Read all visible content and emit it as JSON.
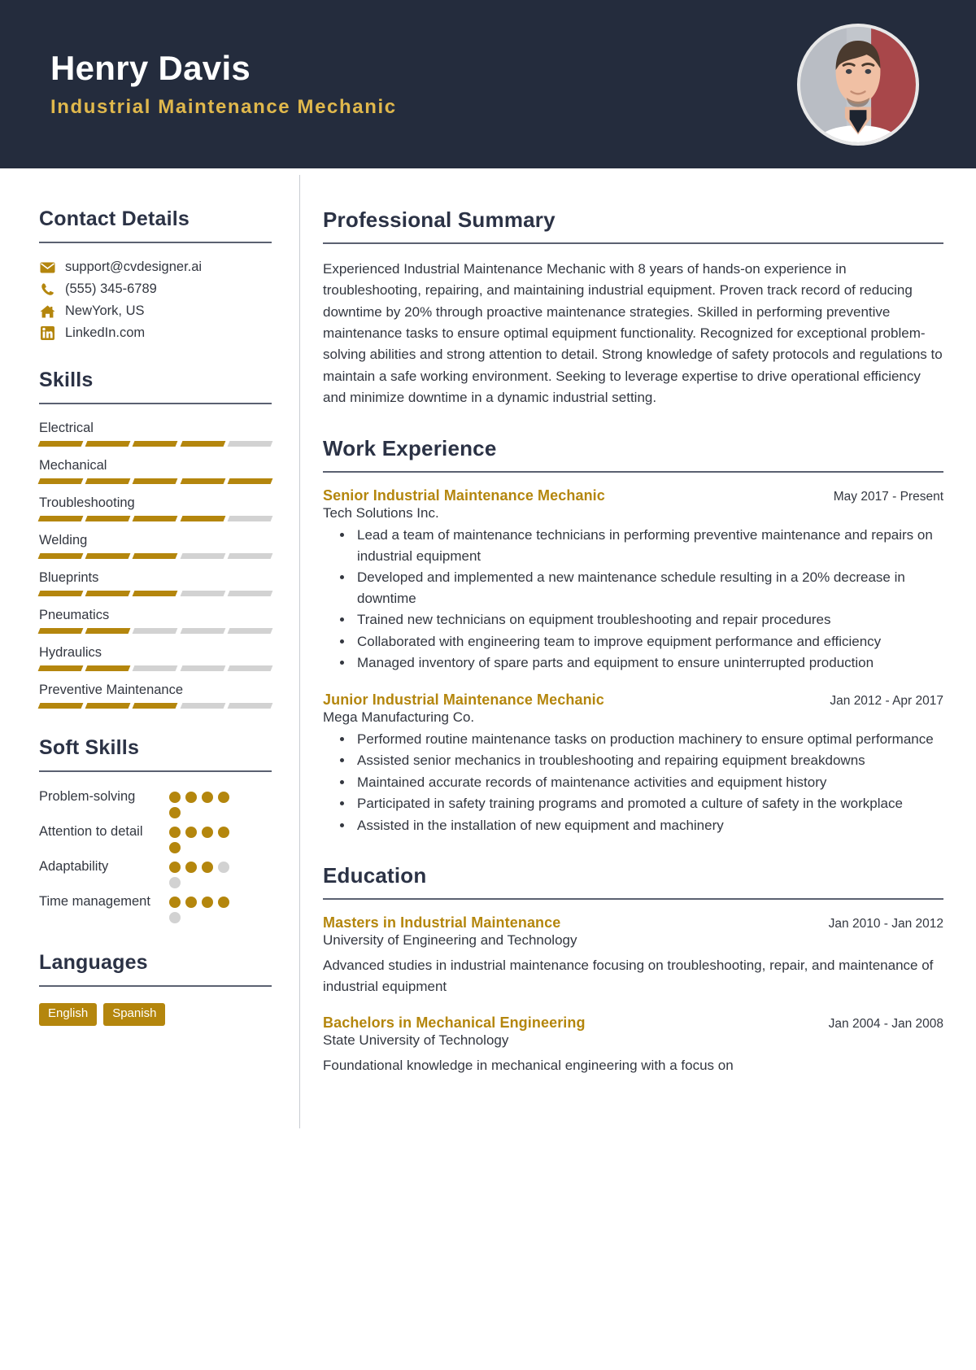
{
  "header": {
    "name": "Henry Davis",
    "job_title": "Industrial Maintenance Mechanic",
    "avatar_icon": "user-photo",
    "bg_color": "#242c3d",
    "accent_color": "#e0b84c"
  },
  "theme": {
    "accent": "#b4860d",
    "dark": "#2b3245",
    "muted": "#d2d2d2"
  },
  "sidebar": {
    "contact": {
      "heading": "Contact Details",
      "items": [
        {
          "icon": "envelope-icon",
          "value": "support@cvdesigner.ai"
        },
        {
          "icon": "phone-icon",
          "value": "(555) 345-6789"
        },
        {
          "icon": "home-icon",
          "value": "NewYork, US"
        },
        {
          "icon": "linkedin-icon",
          "value": "LinkedIn.com"
        }
      ]
    },
    "skills": {
      "heading": "Skills",
      "max": 5,
      "items": [
        {
          "name": "Electrical",
          "level": 4
        },
        {
          "name": "Mechanical",
          "level": 5
        },
        {
          "name": "Troubleshooting",
          "level": 4
        },
        {
          "name": "Welding",
          "level": 3
        },
        {
          "name": "Blueprints",
          "level": 3
        },
        {
          "name": "Pneumatics",
          "level": 2
        },
        {
          "name": "Hydraulics",
          "level": 2
        },
        {
          "name": "Preventive Maintenance",
          "level": 3
        }
      ]
    },
    "soft_skills": {
      "heading": "Soft Skills",
      "max": 5,
      "items": [
        {
          "name": "Problem-solving",
          "level": 5
        },
        {
          "name": "Attention to detail",
          "level": 5
        },
        {
          "name": "Adaptability",
          "level": 3
        },
        {
          "name": "Time management",
          "level": 4
        }
      ]
    },
    "languages": {
      "heading": "Languages",
      "items": [
        "English",
        "Spanish"
      ]
    }
  },
  "main": {
    "summary": {
      "heading": "Professional Summary",
      "text": "Experienced Industrial Maintenance Mechanic with 8 years of hands-on experience in troubleshooting, repairing, and maintaining industrial equipment. Proven track record of reducing downtime by 20% through proactive maintenance strategies. Skilled in performing preventive maintenance tasks to ensure optimal equipment functionality. Recognized for exceptional problem-solving abilities and strong attention to detail. Strong knowledge of safety protocols and regulations to maintain a safe working environment. Seeking to leverage expertise to drive operational efficiency and minimize downtime in a dynamic industrial setting."
    },
    "work_experience": {
      "heading": "Work Experience",
      "entries": [
        {
          "title": "Senior Industrial Maintenance Mechanic",
          "date": "May 2017 - Present",
          "organization": "Tech Solutions Inc.",
          "bullets": [
            "Lead a team of maintenance technicians in performing preventive maintenance and repairs on industrial equipment",
            "Developed and implemented a new maintenance schedule resulting in a 20% decrease in downtime",
            "Trained new technicians on equipment troubleshooting and repair procedures",
            "Collaborated with engineering team to improve equipment performance and efficiency",
            "Managed inventory of spare parts and equipment to ensure uninterrupted production"
          ]
        },
        {
          "title": "Junior Industrial Maintenance Mechanic",
          "date": "Jan 2012 - Apr 2017",
          "organization": "Mega Manufacturing Co.",
          "bullets": [
            "Performed routine maintenance tasks on production machinery to ensure optimal performance",
            "Assisted senior mechanics in troubleshooting and repairing equipment breakdowns",
            "Maintained accurate records of maintenance activities and equipment history",
            "Participated in safety training programs and promoted a culture of safety in the workplace",
            "Assisted in the installation of new equipment and machinery"
          ]
        }
      ]
    },
    "education": {
      "heading": "Education",
      "entries": [
        {
          "title": "Masters in Industrial Maintenance",
          "date": "Jan 2010 - Jan 2012",
          "organization": "University of Engineering and Technology",
          "description": "Advanced studies in industrial maintenance focusing on troubleshooting, repair, and maintenance of industrial equipment"
        },
        {
          "title": "Bachelors in Mechanical Engineering",
          "date": "Jan 2004 - Jan 2008",
          "organization": "State University of Technology",
          "description": "Foundational knowledge in mechanical engineering with a focus on"
        }
      ]
    }
  }
}
